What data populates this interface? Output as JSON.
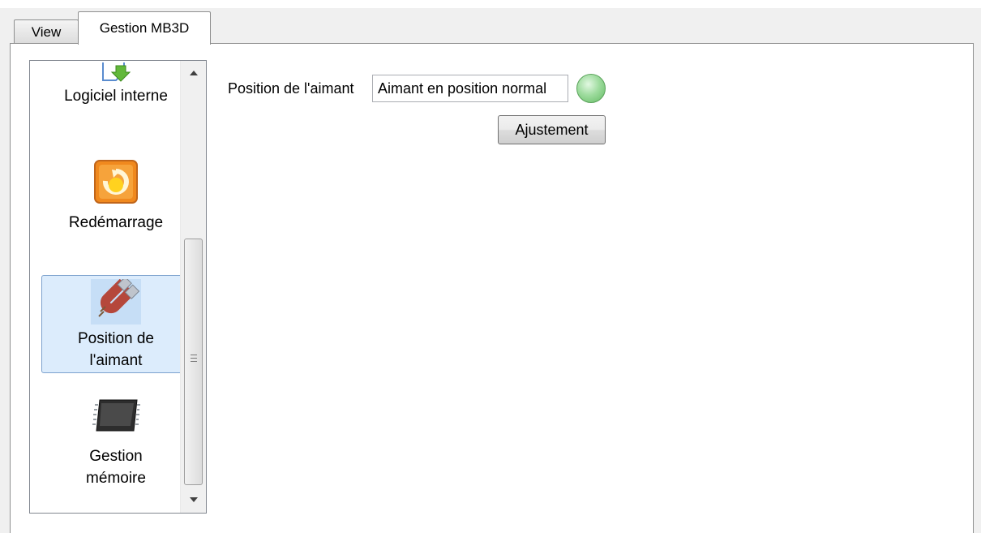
{
  "tabs": [
    {
      "label": "View",
      "active": false
    },
    {
      "label": "Gestion MB3D",
      "active": true
    }
  ],
  "sidebar": {
    "items": [
      {
        "label": "Logiciel interne",
        "icon": "download-arrow-icon",
        "selected": false
      },
      {
        "label": "Redémarrage",
        "icon": "restart-icon",
        "selected": false
      },
      {
        "label": "Position de l'aimant",
        "label_lines": [
          "Position de",
          "l'aimant"
        ],
        "icon": "magnet-icon",
        "selected": true
      },
      {
        "label": "Gestion mémoire",
        "label_lines": [
          "Gestion",
          "mémoire"
        ],
        "icon": "memory-chip-icon",
        "selected": false
      }
    ],
    "scrollbar": {
      "grip_icon": "grip-icon"
    }
  },
  "main": {
    "magnet_position": {
      "label": "Position de l'aimant",
      "value": "Aimant en position normal",
      "status_color": "#8fd68f"
    },
    "adjust_button": "Ajustement"
  },
  "colors": {
    "selection_bg": "#dcecfc",
    "selection_border": "#7da2ce"
  }
}
